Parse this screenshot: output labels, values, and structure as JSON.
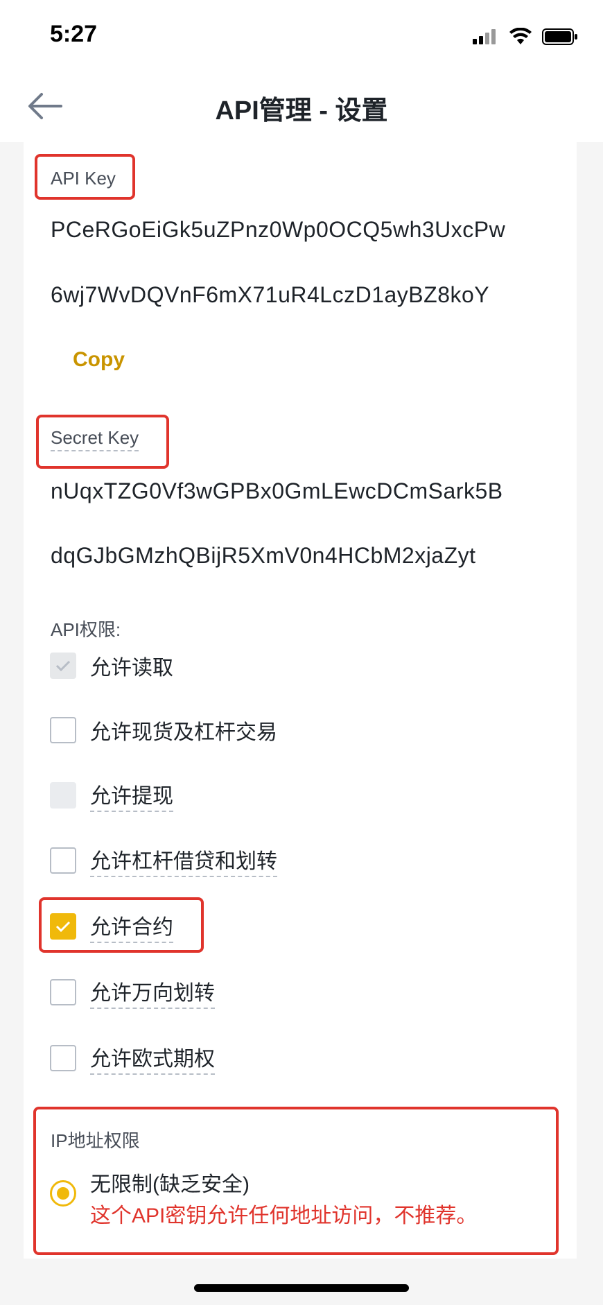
{
  "status_bar": {
    "time": "5:27"
  },
  "header": {
    "title": "API管理 - 设置",
    "back_icon": "back-arrow-icon"
  },
  "api_key": {
    "label": "API Key",
    "lines": [
      "PCeRGoEiGk5uZPnz0Wp0OCQ5wh3UxcPw",
      "6wj7WvDQVnF6mX71uR4LczD1ayBZ8koY"
    ],
    "copy_label": "Copy"
  },
  "secret_key": {
    "label": "Secret Key",
    "lines": [
      "nUqxTZG0Vf3wGPBx0GmLEwcDCmSark5B",
      "dqGJbGMzhQBijR5XmV0n4HCbM2xjaZyt"
    ]
  },
  "permissions": {
    "title": "API权限:",
    "items": [
      {
        "label": "允许读取",
        "checked": true,
        "disabled": true
      },
      {
        "label": "允许现货及杠杆交易",
        "checked": false,
        "disabled": false
      },
      {
        "label": "允许提现",
        "checked": false,
        "disabled": true
      },
      {
        "label": "允许杠杆借贷和划转",
        "checked": false,
        "disabled": false
      },
      {
        "label": "允许合约",
        "checked": true,
        "disabled": false
      },
      {
        "label": "允许万向划转",
        "checked": false,
        "disabled": false
      },
      {
        "label": "允许欧式期权",
        "checked": false,
        "disabled": false
      }
    ]
  },
  "ip_restriction": {
    "title": "IP地址权限",
    "option_label": "无限制(缺乏安全)",
    "warning": "这个API密钥允许任何地址访问，不推荐。",
    "selected": true
  },
  "colors": {
    "accent": "#f0b90b",
    "link": "#c99400",
    "warning": "#e0342c",
    "highlight": "#e0342c"
  }
}
